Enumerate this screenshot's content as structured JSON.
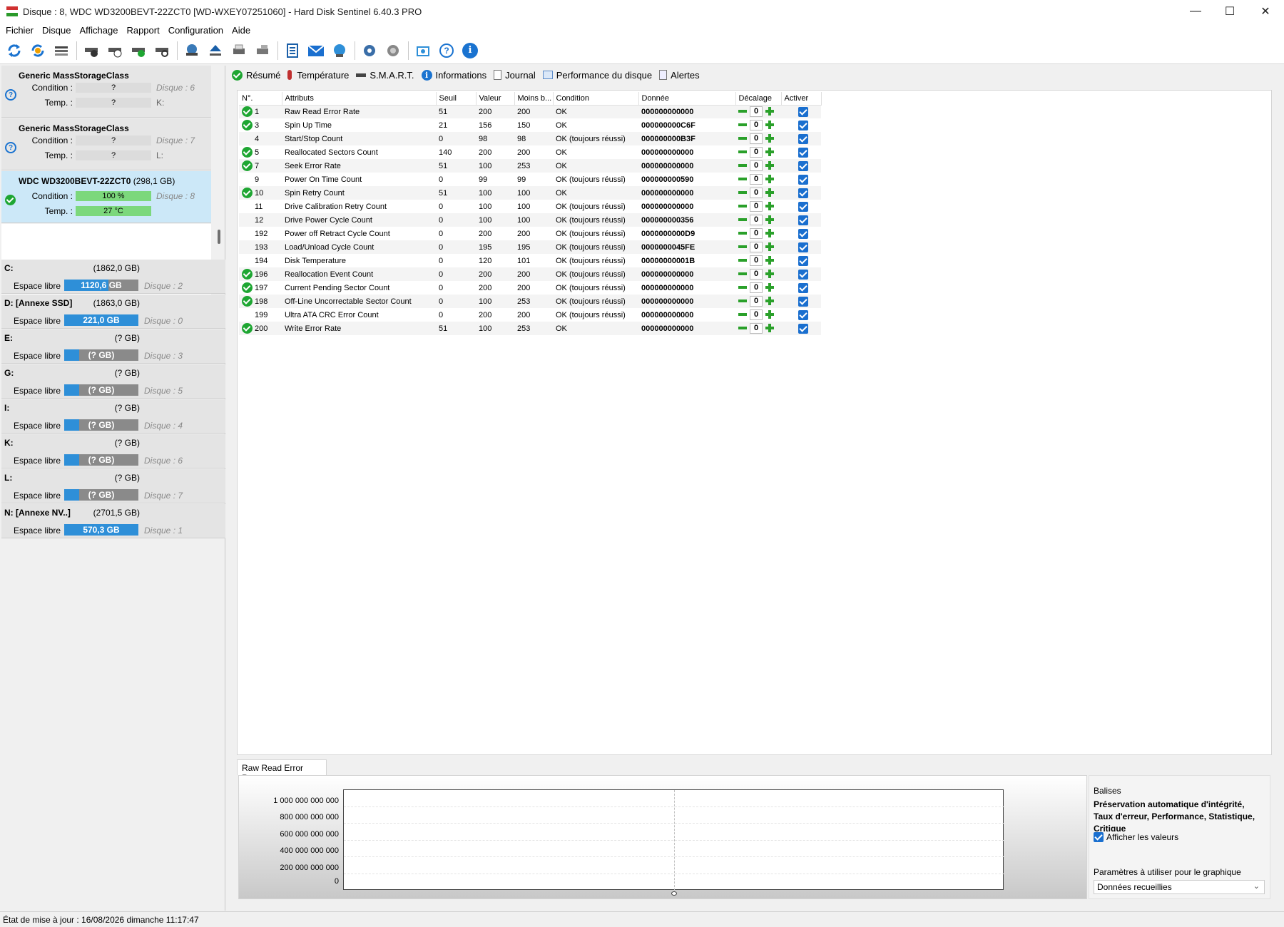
{
  "window": {
    "title": "Disque : 8, WDC WD3200BEVT-22ZCT0 [WD-WXEY07251060]  -  Hard Disk Sentinel 6.40.3 PRO",
    "minimize": "—",
    "maximize": "☐",
    "close": "✕"
  },
  "menu": [
    "Fichier",
    "Disque",
    "Affichage",
    "Rapport",
    "Configuration",
    "Aide"
  ],
  "toolbar": {
    "icons": [
      "refresh-icon",
      "refresh-warning-icon",
      "disk-list-icon",
      "disk-test-icon",
      "disk-timer-icon",
      "disk-ok-icon",
      "disk-search-icon",
      "network-disk-icon",
      "eject-icon",
      "printer-icon",
      "disk-export-icon",
      "report-icon",
      "email-icon",
      "web-icon",
      "settings-icon",
      "sound-icon",
      "screenshot-icon",
      "help-icon",
      "info-icon"
    ]
  },
  "disks": [
    {
      "name": "Generic MassStorageClass",
      "size": "",
      "condition_label": "Condition :",
      "condition": "?",
      "temp_label": "Temp. :",
      "temp": "?",
      "disk_no": "Disque : 6",
      "letter": "K:",
      "status": "unknown"
    },
    {
      "name": "Generic MassStorageClass",
      "size": "",
      "condition_label": "Condition :",
      "condition": "?",
      "temp_label": "Temp. :",
      "temp": "?",
      "disk_no": "Disque : 7",
      "letter": "L:",
      "status": "unknown"
    },
    {
      "name": "WDC WD3200BEVT-22ZCT0",
      "size": "(298,1 GB)",
      "condition_label": "Condition :",
      "condition": "100 %",
      "temp_label": "Temp. :",
      "temp": "27 °C",
      "disk_no": "Disque : 8",
      "letter": "",
      "status": "ok"
    }
  ],
  "volumes": [
    {
      "letter": "C:",
      "size": "(1862,0 GB)",
      "free_label": "Espace libre",
      "free": "1120,6 GB",
      "fill_pct": 60,
      "disk": "Disque : 2"
    },
    {
      "letter": "D: [Annexe SSD]",
      "size": "(1863,0 GB)",
      "free_label": "Espace libre",
      "free": "221,0 GB",
      "fill_pct": 100,
      "disk": "Disque : 0"
    },
    {
      "letter": "E:",
      "size": "(? GB)",
      "free_label": "Espace libre",
      "free": "(? GB)",
      "fill_pct": 20,
      "disk": "Disque : 3"
    },
    {
      "letter": "G:",
      "size": "(? GB)",
      "free_label": "Espace libre",
      "free": "(? GB)",
      "fill_pct": 20,
      "disk": "Disque : 5"
    },
    {
      "letter": "I:",
      "size": "(? GB)",
      "free_label": "Espace libre",
      "free": "(? GB)",
      "fill_pct": 20,
      "disk": "Disque : 4"
    },
    {
      "letter": "K:",
      "size": "(? GB)",
      "free_label": "Espace libre",
      "free": "(? GB)",
      "fill_pct": 20,
      "disk": "Disque : 6"
    },
    {
      "letter": "L:",
      "size": "(? GB)",
      "free_label": "Espace libre",
      "free": "(? GB)",
      "fill_pct": 20,
      "disk": "Disque : 7"
    },
    {
      "letter": "N: [Annexe NV..]",
      "size": "(2701,5 GB)",
      "free_label": "Espace libre",
      "free": "570,3 GB",
      "fill_pct": 100,
      "disk": "Disque : 1"
    }
  ],
  "tabs": [
    "Résumé",
    "Température",
    "S.M.A.R.T.",
    "Informations",
    "Journal",
    "Performance du disque",
    "Alertes"
  ],
  "smart": {
    "headers": [
      "N°.",
      "Attributs",
      "Seuil",
      "Valeur",
      "Moins b...",
      "Condition",
      "Donnée",
      "Décalage",
      "Activer"
    ],
    "rows": [
      {
        "ok": true,
        "no": "1",
        "attr": "Raw Read Error Rate",
        "seuil": "51",
        "valeur": "200",
        "moins": "200",
        "cond": "OK",
        "data": "000000000000",
        "offset": "0"
      },
      {
        "ok": true,
        "no": "3",
        "attr": "Spin Up Time",
        "seuil": "21",
        "valeur": "156",
        "moins": "150",
        "cond": "OK",
        "data": "000000000C6F",
        "offset": "0"
      },
      {
        "ok": false,
        "no": "4",
        "attr": "Start/Stop Count",
        "seuil": "0",
        "valeur": "98",
        "moins": "98",
        "cond": "OK (toujours réussi)",
        "data": "000000000B3F",
        "offset": "0"
      },
      {
        "ok": true,
        "no": "5",
        "attr": "Reallocated Sectors Count",
        "seuil": "140",
        "valeur": "200",
        "moins": "200",
        "cond": "OK",
        "data": "000000000000",
        "offset": "0"
      },
      {
        "ok": true,
        "no": "7",
        "attr": "Seek Error Rate",
        "seuil": "51",
        "valeur": "100",
        "moins": "253",
        "cond": "OK",
        "data": "000000000000",
        "offset": "0"
      },
      {
        "ok": false,
        "no": "9",
        "attr": "Power On Time Count",
        "seuil": "0",
        "valeur": "99",
        "moins": "99",
        "cond": "OK (toujours réussi)",
        "data": "000000000590",
        "offset": "0"
      },
      {
        "ok": true,
        "no": "10",
        "attr": "Spin Retry Count",
        "seuil": "51",
        "valeur": "100",
        "moins": "100",
        "cond": "OK",
        "data": "000000000000",
        "offset": "0"
      },
      {
        "ok": false,
        "no": "11",
        "attr": "Drive Calibration Retry Count",
        "seuil": "0",
        "valeur": "100",
        "moins": "100",
        "cond": "OK (toujours réussi)",
        "data": "000000000000",
        "offset": "0"
      },
      {
        "ok": false,
        "no": "12",
        "attr": "Drive Power Cycle Count",
        "seuil": "0",
        "valeur": "100",
        "moins": "100",
        "cond": "OK (toujours réussi)",
        "data": "000000000356",
        "offset": "0"
      },
      {
        "ok": false,
        "no": "192",
        "attr": "Power off Retract Cycle Count",
        "seuil": "0",
        "valeur": "200",
        "moins": "200",
        "cond": "OK (toujours réussi)",
        "data": "0000000000D9",
        "offset": "0"
      },
      {
        "ok": false,
        "no": "193",
        "attr": "Load/Unload Cycle Count",
        "seuil": "0",
        "valeur": "195",
        "moins": "195",
        "cond": "OK (toujours réussi)",
        "data": "0000000045FE",
        "offset": "0"
      },
      {
        "ok": false,
        "no": "194",
        "attr": "Disk Temperature",
        "seuil": "0",
        "valeur": "120",
        "moins": "101",
        "cond": "OK (toujours réussi)",
        "data": "00000000001B",
        "offset": "0"
      },
      {
        "ok": true,
        "no": "196",
        "attr": "Reallocation Event Count",
        "seuil": "0",
        "valeur": "200",
        "moins": "200",
        "cond": "OK (toujours réussi)",
        "data": "000000000000",
        "offset": "0"
      },
      {
        "ok": true,
        "no": "197",
        "attr": "Current Pending Sector Count",
        "seuil": "0",
        "valeur": "200",
        "moins": "200",
        "cond": "OK (toujours réussi)",
        "data": "000000000000",
        "offset": "0"
      },
      {
        "ok": true,
        "no": "198",
        "attr": "Off-Line Uncorrectable Sector Count",
        "seuil": "0",
        "valeur": "100",
        "moins": "253",
        "cond": "OK (toujours réussi)",
        "data": "000000000000",
        "offset": "0"
      },
      {
        "ok": false,
        "no": "199",
        "attr": "Ultra ATA CRC Error Count",
        "seuil": "0",
        "valeur": "200",
        "moins": "200",
        "cond": "OK (toujours réussi)",
        "data": "000000000000",
        "offset": "0"
      },
      {
        "ok": true,
        "no": "200",
        "attr": "Write Error Rate",
        "seuil": "51",
        "valeur": "100",
        "moins": "253",
        "cond": "OK",
        "data": "000000000000",
        "offset": "0"
      }
    ]
  },
  "graph": {
    "tab_label": "Raw Read Error Rate",
    "y_ticks": [
      "1 000 000 000 000",
      "800 000 000 000",
      "600 000 000 000",
      "400 000 000 000",
      "200 000 000 000",
      "0"
    ],
    "sidebar": {
      "balises_label": "Balises",
      "balises_value": "Préservation automatique d'intégrité, Taux d'erreur, Performance, Statistique, Critique",
      "show_values_label": "Afficher les valeurs",
      "params_label": "Paramètres à utiliser pour le graphique",
      "params_value": "Données recueillies"
    }
  },
  "status_bar": "État de mise à jour : 16/08/2026 dimanche 11:17:47",
  "colors": {
    "ok_green": "#1ea632",
    "bar_blue": "#2e8fd8",
    "selected_disk": "#cce8f8",
    "condition_green": "#7cd87c"
  }
}
